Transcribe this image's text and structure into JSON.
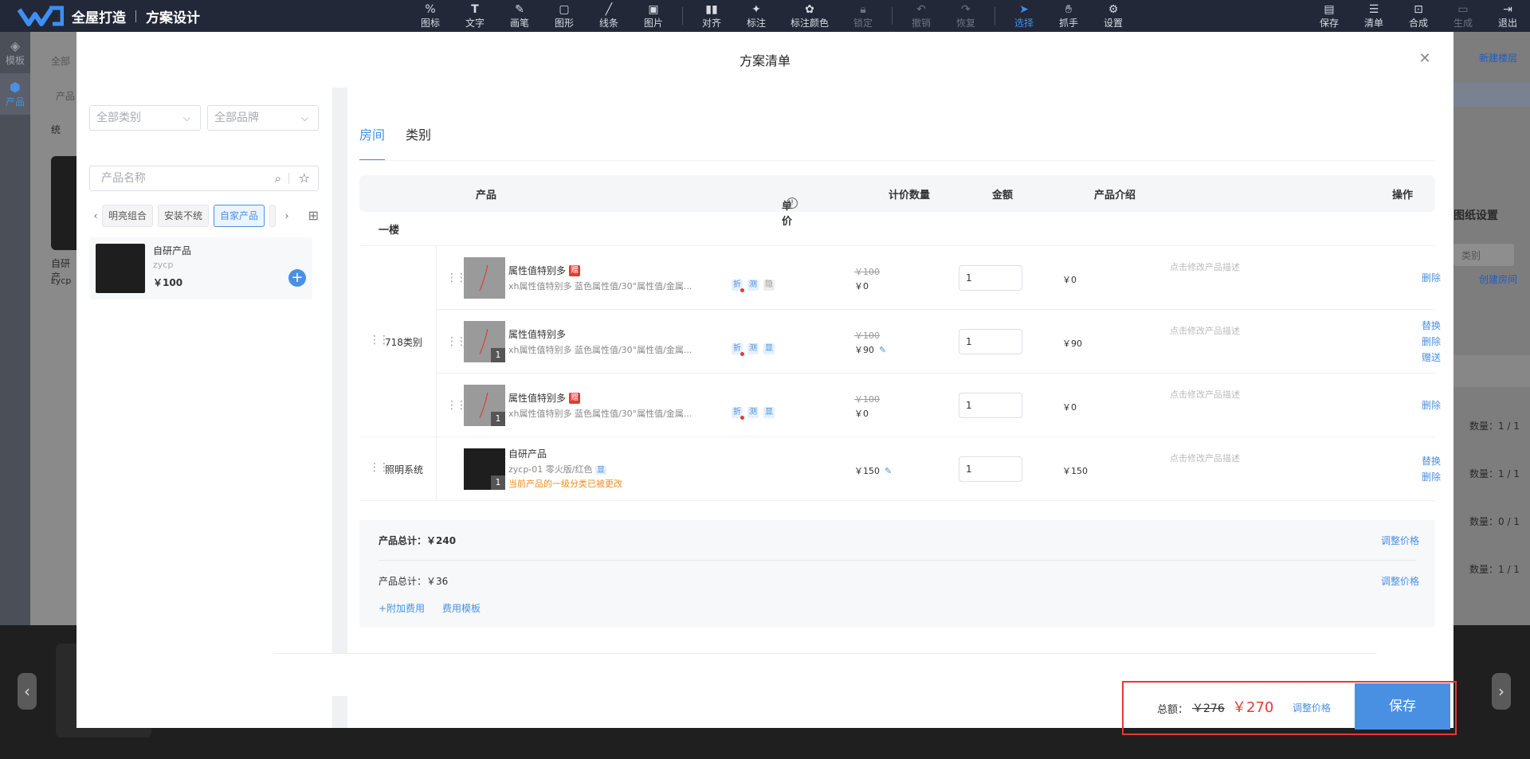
{
  "app": {
    "brand": "全屋打造",
    "section": "方案设计"
  },
  "toolbar": {
    "tools": [
      {
        "label": "图标",
        "icon": "icon-tool"
      },
      {
        "label": "文字",
        "icon": "text-tool"
      },
      {
        "label": "画笔",
        "icon": "brush-tool"
      },
      {
        "label": "图形",
        "icon": "shape-tool"
      },
      {
        "label": "线条",
        "icon": "line-tool"
      },
      {
        "label": "图片",
        "icon": "image-tool"
      },
      {
        "label": "对齐",
        "icon": "align-tool"
      },
      {
        "label": "标注",
        "icon": "annotate-tool"
      },
      {
        "label": "标注颜色",
        "icon": "annotate-color-tool"
      },
      {
        "label": "锁定",
        "icon": "lock-tool"
      },
      {
        "label": "撤销",
        "icon": "undo-tool"
      },
      {
        "label": "恢复",
        "icon": "redo-tool"
      },
      {
        "label": "选择",
        "icon": "select-tool"
      },
      {
        "label": "抓手",
        "icon": "hand-tool"
      },
      {
        "label": "设置",
        "icon": "settings-tool"
      }
    ],
    "right": [
      {
        "label": "保存"
      },
      {
        "label": "清单"
      },
      {
        "label": "合成"
      },
      {
        "label": "生成"
      },
      {
        "label": "退出"
      }
    ]
  },
  "leftnav": {
    "items": [
      {
        "label": "模板"
      },
      {
        "label": "产品"
      }
    ]
  },
  "background": {
    "left_texts": [
      "全部",
      "产品",
      "统",
      "自研产",
      "zycp"
    ],
    "right": {
      "new_floor": "新建楼层",
      "drawing_settings": "图纸设置",
      "category_ph": "类别",
      "create_room": "创建房间",
      "counts": [
        "数量：1 / 1",
        "数量：1 / 1",
        "数量：0 / 1",
        "数量：1 / 1"
      ]
    }
  },
  "modal": {
    "title": "方案清单"
  },
  "library": {
    "category_select": "全部类别",
    "brand_select": "全部品牌",
    "search_placeholder": "产品名称",
    "chips": [
      "明亮组合",
      "安装不统",
      "自家产品"
    ],
    "card": {
      "name": "自研产品",
      "code": "zycp",
      "price": "￥100"
    }
  },
  "tabs": [
    {
      "label": "房间"
    },
    {
      "label": "类别"
    }
  ],
  "table": {
    "headers": {
      "product": "产品",
      "unit_price": "单价",
      "qty": "计价数量",
      "amount": "金额",
      "intro": "产品介绍",
      "ops": "操作"
    },
    "floor": "一楼",
    "categories": [
      {
        "name": "718类别"
      },
      {
        "name": "照明系统"
      }
    ],
    "rows": [
      {
        "name": "属性值特别多",
        "gift": "赠",
        "desc": "xh属性值特别多 蓝色属性值/30°属性值/金属...",
        "tags": [
          "折",
          "测",
          "隐"
        ],
        "old_price": "￥100",
        "price": "￥0",
        "qty": "1",
        "amount": "￥0",
        "intro": "点击修改产品描述",
        "ops": [
          "删除"
        ]
      },
      {
        "name": "属性值特别多",
        "desc": "xh属性值特别多 蓝色属性值/30°属性值/金属...",
        "tags": [
          "折",
          "测",
          "显"
        ],
        "old_price": "￥100",
        "price": "￥90",
        "qty": "1",
        "amount": "￥90",
        "intro": "点击修改产品描述",
        "badge": "1",
        "ops": [
          "替换",
          "删除",
          "赠送"
        ]
      },
      {
        "name": "属性值特别多",
        "gift": "赠",
        "desc": "xh属性值特别多 蓝色属性值/30°属性值/金属...",
        "tags": [
          "折",
          "测",
          "显"
        ],
        "old_price": "￥100",
        "price": "￥0",
        "qty": "1",
        "amount": "￥0",
        "intro": "点击修改产品描述",
        "badge": "1",
        "ops": [
          "删除"
        ]
      },
      {
        "name": "自研产品",
        "desc": "zycp-01 零火版/红色",
        "tags": [
          "显"
        ],
        "warning": "当前产品的一级分类已被更改",
        "price": "￥150",
        "qty": "1",
        "amount": "￥150",
        "intro": "点击修改产品描述",
        "badge": "1",
        "ops": [
          "替换",
          "删除"
        ]
      }
    ]
  },
  "summary": {
    "product_total_label": "产品总计：",
    "product_total": "￥240",
    "adjust": "调整价格",
    "fee_total_label": "产品总计：",
    "fee_total": "￥36",
    "add_fee": "+附加费用",
    "fee_template": "费用模板"
  },
  "footer": {
    "total_label": "总额：",
    "old_total": "￥276",
    "total": "￥270",
    "adjust": "调整价格",
    "save": "保存"
  },
  "colors": {
    "accent": "#4a90e2",
    "danger": "#e53935",
    "warning": "#f08c1c",
    "topbar": "#222838"
  }
}
